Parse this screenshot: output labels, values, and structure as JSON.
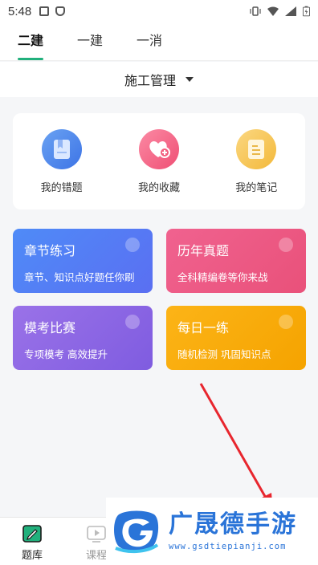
{
  "status_bar": {
    "time": "5:48"
  },
  "tabs": [
    {
      "label": "二建",
      "active": true
    },
    {
      "label": "一建",
      "active": false
    },
    {
      "label": "一消",
      "active": false
    }
  ],
  "subject_selector": {
    "label": "施工管理"
  },
  "quick_actions": [
    {
      "label": "我的错题",
      "icon": "bookmark-book-icon",
      "color": "#4a82ec"
    },
    {
      "label": "我的收藏",
      "icon": "heart-plus-icon",
      "color": "#f2607f"
    },
    {
      "label": "我的笔记",
      "icon": "note-icon",
      "color": "#f5c24c"
    }
  ],
  "features": [
    {
      "title": "章节练习",
      "subtitle": "章节、知识点好题任你刷",
      "color": "#4f8bf7"
    },
    {
      "title": "历年真题",
      "subtitle": "全科精编卷等你来战",
      "color": "#ee5a85"
    },
    {
      "title": "模考比赛",
      "subtitle": "专项模考 高效提升",
      "color": "#8d67e4"
    },
    {
      "title": "每日一练",
      "subtitle": "随机检测 巩固知识点",
      "color": "#fbb10d"
    }
  ],
  "bottom_nav": [
    {
      "label": "题库",
      "icon": "question-bank-icon",
      "active": true
    },
    {
      "label": "课程",
      "icon": "video-course-icon",
      "active": false
    }
  ],
  "watermark": {
    "name": "广晟德手游",
    "url": "www.gsdtiepianji.com"
  },
  "accent_color": "#21b07c"
}
